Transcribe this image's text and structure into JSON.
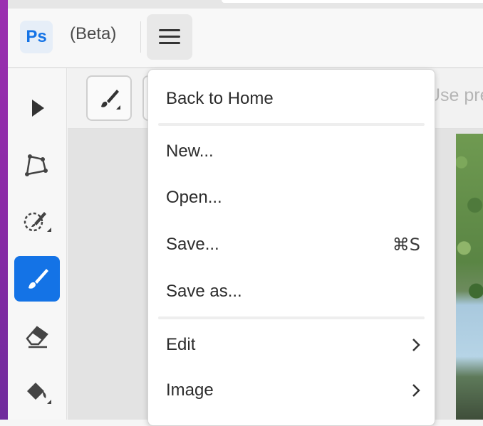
{
  "app": {
    "logo_text": "Ps",
    "badge": "(Beta)"
  },
  "options_bar": {
    "hint_text": "Use pre"
  },
  "menu": {
    "items": [
      {
        "label": "Back to Home"
      },
      {
        "label": "New..."
      },
      {
        "label": "Open..."
      },
      {
        "label": "Save...",
        "shortcut": "⌘S"
      },
      {
        "label": "Save as..."
      },
      {
        "label": "Edit",
        "submenu": true
      },
      {
        "label": "Image",
        "submenu": true
      }
    ]
  },
  "tools": [
    {
      "icon": "select-arrow-icon"
    },
    {
      "icon": "polygon-lasso-icon"
    },
    {
      "icon": "quick-select-brush-icon"
    },
    {
      "icon": "brush-icon",
      "active": true
    },
    {
      "icon": "eraser-icon"
    },
    {
      "icon": "paint-bucket-icon"
    }
  ],
  "colors": {
    "accent": "#1473e6",
    "desktop": "#8a2aa6"
  }
}
